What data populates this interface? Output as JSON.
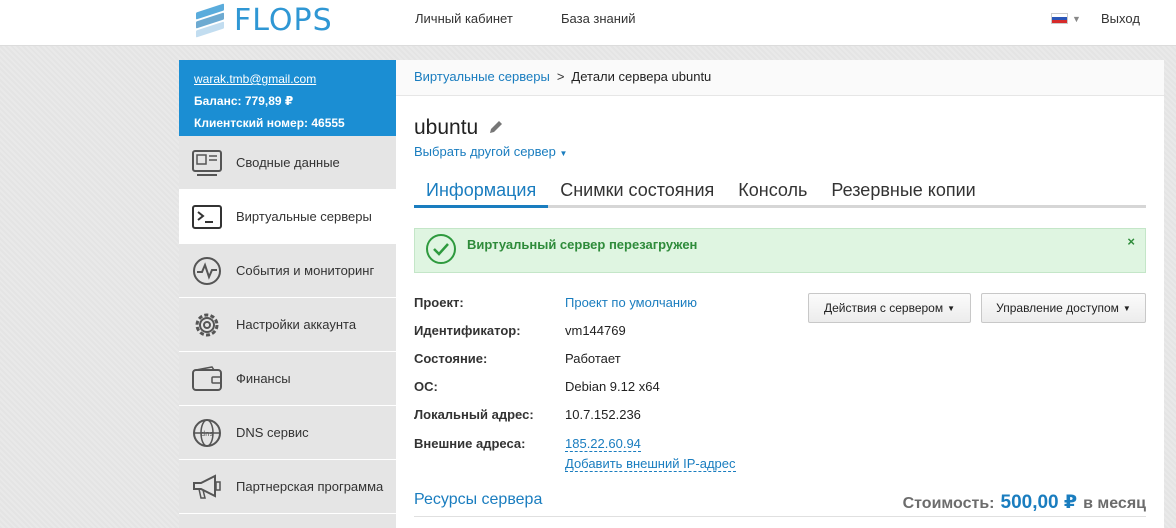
{
  "header": {
    "logo_text": "FLOPS",
    "nav": [
      "Личный кабинет",
      "База знаний"
    ],
    "logout": "Выход",
    "lang_flag": "ru-flag-icon"
  },
  "user": {
    "email": "warak.tmb@gmail.com",
    "balance": "Баланс: 779,89 ₽",
    "client_number": "Клиентский номер: 46555"
  },
  "sidebar": {
    "items": [
      {
        "label": "Сводные данные",
        "icon": "dashboard-icon"
      },
      {
        "label": "Виртуальные серверы",
        "icon": "terminal-icon",
        "active": true
      },
      {
        "label": "События и мониторинг",
        "icon": "monitoring-icon"
      },
      {
        "label": "Настройки аккаунта",
        "icon": "gear-icon"
      },
      {
        "label": "Финансы",
        "icon": "wallet-icon"
      },
      {
        "label": "DNS сервис",
        "icon": "globe-icon"
      },
      {
        "label": "Партнерская программа",
        "icon": "megaphone-icon"
      }
    ]
  },
  "breadcrumb": {
    "parent": "Виртуальные серверы",
    "separator": ">",
    "current": "Детали сервера ubuntu"
  },
  "server": {
    "name": "ubuntu",
    "switch_label": "Выбрать другой сервер"
  },
  "tabs": [
    "Информация",
    "Снимки состояния",
    "Консоль",
    "Резервные копии"
  ],
  "alert": {
    "text": "Виртуальный сервер перезагружен",
    "close": "×"
  },
  "details": {
    "project_label": "Проект:",
    "project_value": "Проект по умолчанию",
    "id_label": "Идентификатор:",
    "id_value": "vm144769",
    "state_label": "Состояние:",
    "state_value": "Работает",
    "os_label": "ОС:",
    "os_value": "Debian 9.12 x64",
    "local_label": "Локальный адрес:",
    "local_value": "10.7.152.236",
    "external_label": "Внешние адреса:",
    "external_value": "185.22.60.94",
    "add_ip": "Добавить внешний IP-адрес"
  },
  "buttons": {
    "server_actions": "Действия с сервером",
    "access": "Управление доступом"
  },
  "resources": {
    "title": "Ресурсы сервера",
    "cost_label": "Стоимость:",
    "cost_value": "500,00 ₽",
    "cost_period": "в месяц"
  },
  "colors": {
    "accent": "#1a7dbf",
    "sidebar_header": "#1b8ed3",
    "success_bg": "#dff5e1",
    "success_text": "#2e8b3a"
  }
}
